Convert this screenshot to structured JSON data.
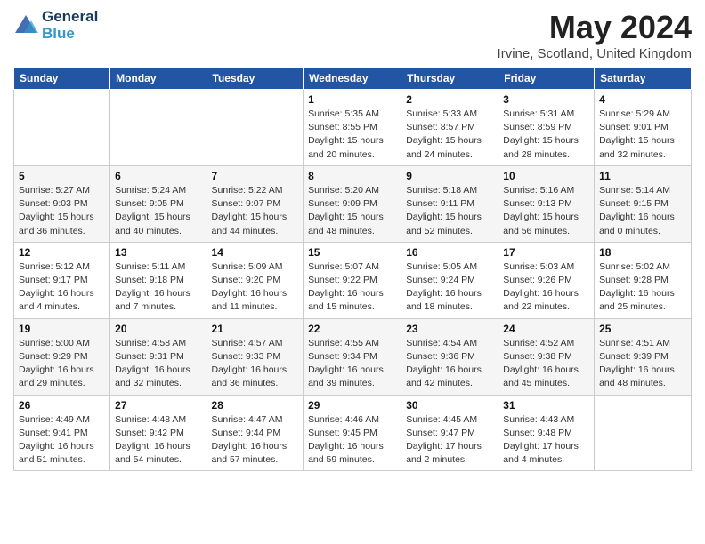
{
  "header": {
    "logo_line1": "General",
    "logo_line2": "Blue",
    "month_title": "May 2024",
    "location": "Irvine, Scotland, United Kingdom"
  },
  "days_of_week": [
    "Sunday",
    "Monday",
    "Tuesday",
    "Wednesday",
    "Thursday",
    "Friday",
    "Saturday"
  ],
  "weeks": [
    [
      {
        "day": "",
        "info": ""
      },
      {
        "day": "",
        "info": ""
      },
      {
        "day": "",
        "info": ""
      },
      {
        "day": "1",
        "info": "Sunrise: 5:35 AM\nSunset: 8:55 PM\nDaylight: 15 hours\nand 20 minutes."
      },
      {
        "day": "2",
        "info": "Sunrise: 5:33 AM\nSunset: 8:57 PM\nDaylight: 15 hours\nand 24 minutes."
      },
      {
        "day": "3",
        "info": "Sunrise: 5:31 AM\nSunset: 8:59 PM\nDaylight: 15 hours\nand 28 minutes."
      },
      {
        "day": "4",
        "info": "Sunrise: 5:29 AM\nSunset: 9:01 PM\nDaylight: 15 hours\nand 32 minutes."
      }
    ],
    [
      {
        "day": "5",
        "info": "Sunrise: 5:27 AM\nSunset: 9:03 PM\nDaylight: 15 hours\nand 36 minutes."
      },
      {
        "day": "6",
        "info": "Sunrise: 5:24 AM\nSunset: 9:05 PM\nDaylight: 15 hours\nand 40 minutes."
      },
      {
        "day": "7",
        "info": "Sunrise: 5:22 AM\nSunset: 9:07 PM\nDaylight: 15 hours\nand 44 minutes."
      },
      {
        "day": "8",
        "info": "Sunrise: 5:20 AM\nSunset: 9:09 PM\nDaylight: 15 hours\nand 48 minutes."
      },
      {
        "day": "9",
        "info": "Sunrise: 5:18 AM\nSunset: 9:11 PM\nDaylight: 15 hours\nand 52 minutes."
      },
      {
        "day": "10",
        "info": "Sunrise: 5:16 AM\nSunset: 9:13 PM\nDaylight: 15 hours\nand 56 minutes."
      },
      {
        "day": "11",
        "info": "Sunrise: 5:14 AM\nSunset: 9:15 PM\nDaylight: 16 hours\nand 0 minutes."
      }
    ],
    [
      {
        "day": "12",
        "info": "Sunrise: 5:12 AM\nSunset: 9:17 PM\nDaylight: 16 hours\nand 4 minutes."
      },
      {
        "day": "13",
        "info": "Sunrise: 5:11 AM\nSunset: 9:18 PM\nDaylight: 16 hours\nand 7 minutes."
      },
      {
        "day": "14",
        "info": "Sunrise: 5:09 AM\nSunset: 9:20 PM\nDaylight: 16 hours\nand 11 minutes."
      },
      {
        "day": "15",
        "info": "Sunrise: 5:07 AM\nSunset: 9:22 PM\nDaylight: 16 hours\nand 15 minutes."
      },
      {
        "day": "16",
        "info": "Sunrise: 5:05 AM\nSunset: 9:24 PM\nDaylight: 16 hours\nand 18 minutes."
      },
      {
        "day": "17",
        "info": "Sunrise: 5:03 AM\nSunset: 9:26 PM\nDaylight: 16 hours\nand 22 minutes."
      },
      {
        "day": "18",
        "info": "Sunrise: 5:02 AM\nSunset: 9:28 PM\nDaylight: 16 hours\nand 25 minutes."
      }
    ],
    [
      {
        "day": "19",
        "info": "Sunrise: 5:00 AM\nSunset: 9:29 PM\nDaylight: 16 hours\nand 29 minutes."
      },
      {
        "day": "20",
        "info": "Sunrise: 4:58 AM\nSunset: 9:31 PM\nDaylight: 16 hours\nand 32 minutes."
      },
      {
        "day": "21",
        "info": "Sunrise: 4:57 AM\nSunset: 9:33 PM\nDaylight: 16 hours\nand 36 minutes."
      },
      {
        "day": "22",
        "info": "Sunrise: 4:55 AM\nSunset: 9:34 PM\nDaylight: 16 hours\nand 39 minutes."
      },
      {
        "day": "23",
        "info": "Sunrise: 4:54 AM\nSunset: 9:36 PM\nDaylight: 16 hours\nand 42 minutes."
      },
      {
        "day": "24",
        "info": "Sunrise: 4:52 AM\nSunset: 9:38 PM\nDaylight: 16 hours\nand 45 minutes."
      },
      {
        "day": "25",
        "info": "Sunrise: 4:51 AM\nSunset: 9:39 PM\nDaylight: 16 hours\nand 48 minutes."
      }
    ],
    [
      {
        "day": "26",
        "info": "Sunrise: 4:49 AM\nSunset: 9:41 PM\nDaylight: 16 hours\nand 51 minutes."
      },
      {
        "day": "27",
        "info": "Sunrise: 4:48 AM\nSunset: 9:42 PM\nDaylight: 16 hours\nand 54 minutes."
      },
      {
        "day": "28",
        "info": "Sunrise: 4:47 AM\nSunset: 9:44 PM\nDaylight: 16 hours\nand 57 minutes."
      },
      {
        "day": "29",
        "info": "Sunrise: 4:46 AM\nSunset: 9:45 PM\nDaylight: 16 hours\nand 59 minutes."
      },
      {
        "day": "30",
        "info": "Sunrise: 4:45 AM\nSunset: 9:47 PM\nDaylight: 17 hours\nand 2 minutes."
      },
      {
        "day": "31",
        "info": "Sunrise: 4:43 AM\nSunset: 9:48 PM\nDaylight: 17 hours\nand 4 minutes."
      },
      {
        "day": "",
        "info": ""
      }
    ]
  ]
}
